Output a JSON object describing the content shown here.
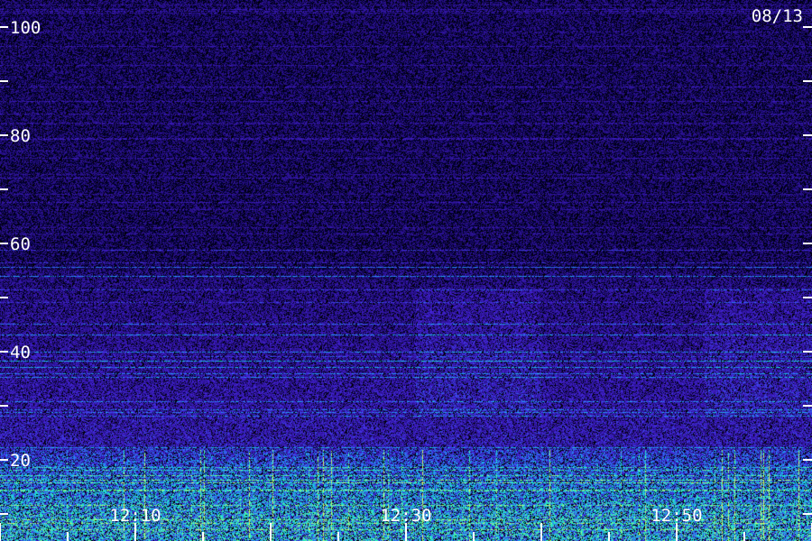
{
  "chart_data": {
    "type": "heatmap",
    "title": "",
    "date": "08/13",
    "xlabel": "",
    "ylabel": "",
    "x_tick_labels": [
      "12:10",
      "12:30",
      "12:50"
    ],
    "y_tick_labels": [
      "100",
      "80",
      "60",
      "40",
      "20"
    ],
    "y_ticks_labeled": [
      100,
      80,
      60,
      40,
      20
    ],
    "y_ticks_minor": [
      90,
      70,
      50,
      30,
      10
    ],
    "ylim": [
      10,
      100
    ],
    "x_tick_minutes": [
      12.1667,
      12.5,
      12.8333
    ],
    "colormap": [
      "#000000",
      "#1a0a6e",
      "#3a22c8",
      "#2a6cff",
      "#19e6d2",
      "#3cff5a",
      "#ffffff"
    ],
    "description_bands": [
      {
        "y_range": [
          10,
          22
        ],
        "intensity": "high"
      },
      {
        "y_range": [
          22,
          55
        ],
        "intensity": "medium"
      },
      {
        "y_range": [
          55,
          100
        ],
        "intensity": "low"
      }
    ]
  }
}
